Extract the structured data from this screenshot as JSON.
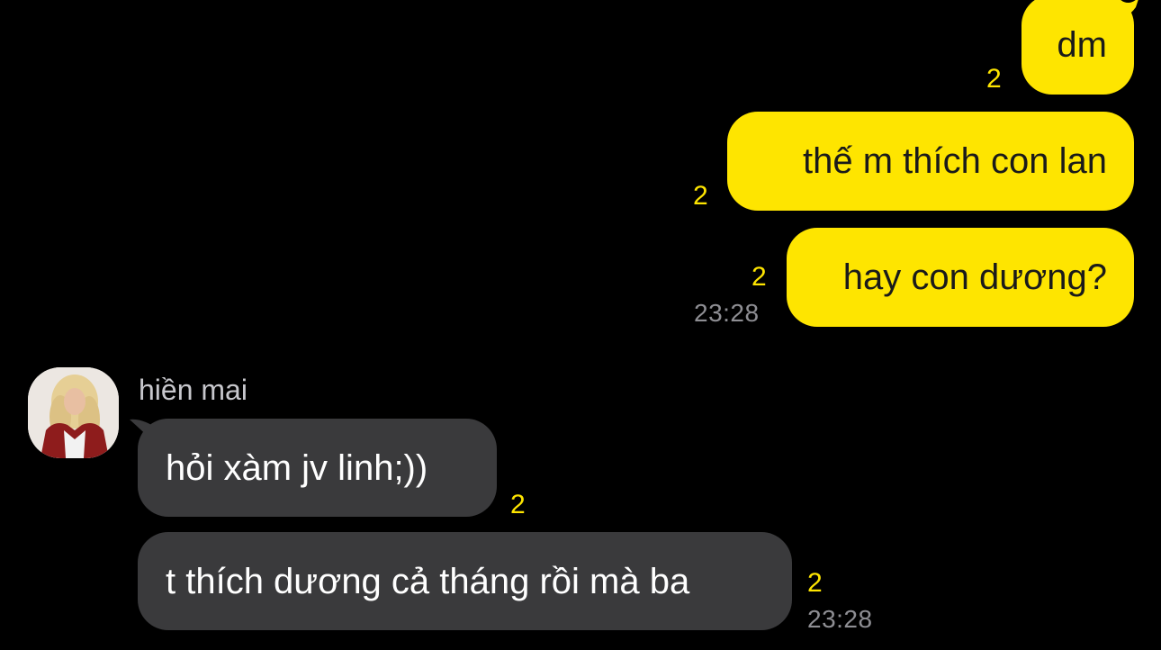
{
  "messages": {
    "outgoing": [
      {
        "text": "dm",
        "unread": "2"
      },
      {
        "text": "thế m thích con lan",
        "unread": "2"
      },
      {
        "text": "hay con dương?",
        "unread": "2",
        "time": "23:28"
      }
    ],
    "incoming": {
      "sender": "hiền mai",
      "items": [
        {
          "text": "hỏi xàm jv linh;))",
          "unread": "2"
        },
        {
          "text": "t thích dương cả tháng rồi mà ba",
          "unread": "2",
          "time": "23:28"
        }
      ]
    }
  },
  "colors": {
    "outgoing_bubble": "#FEE500",
    "incoming_bubble": "#3a3a3c",
    "unread_count": "#FEE500",
    "background": "#000000"
  },
  "icons": {
    "avatar": "profile-photo"
  }
}
